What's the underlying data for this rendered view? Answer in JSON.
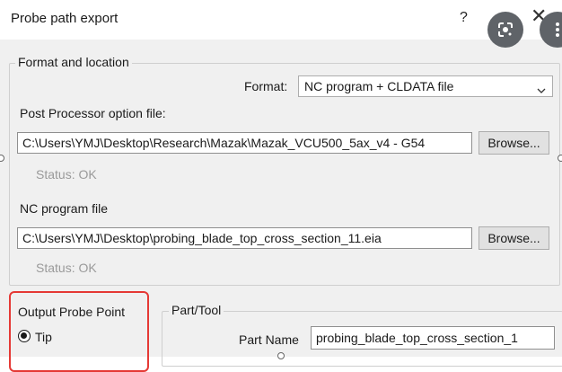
{
  "dialog": {
    "title": "Probe path export",
    "help_label": "?",
    "close_label": "✕"
  },
  "format_group": {
    "title": "Format and location",
    "format_label": "Format:",
    "format_value": "NC program + CLDATA file",
    "post_label": "Post Processor option file:",
    "post_value": "C:\\Users\\YMJ\\Desktop\\Research\\Mazak\\Mazak_VCU500_5ax_v4 - G54",
    "post_browse": "Browse...",
    "post_status": "Status:  OK",
    "nc_label": "NC program file",
    "nc_value": "C:\\Users\\YMJ\\Desktop\\probing_blade_top_cross_section_11.eia",
    "nc_browse": "Browse...",
    "nc_status": "Status:  OK"
  },
  "output_group": {
    "title": "Output Probe Point",
    "tip_label": "Tip",
    "tip_selected": true
  },
  "part_group": {
    "title": "Part/Tool",
    "part_name_label": "Part Name",
    "part_name_value": "probing_blade_top_cross_section_1"
  },
  "icons": {
    "lens": "google-lens-icon",
    "menu": "more-vertical-icon",
    "caret": "chevron-down-icon"
  }
}
